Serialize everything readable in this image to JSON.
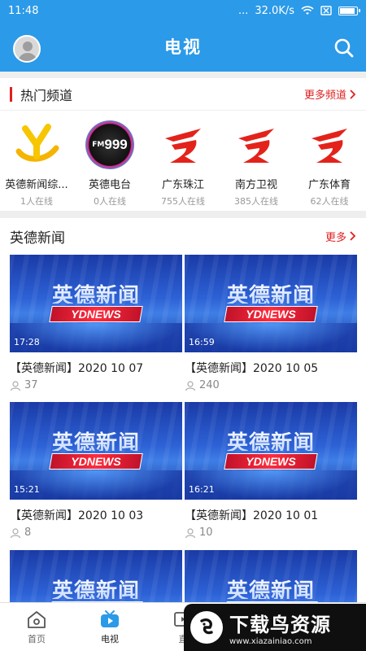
{
  "status": {
    "time": "11:48",
    "dots": "...",
    "speed": "32.0K/s"
  },
  "header": {
    "title": "电视"
  },
  "hot": {
    "title": "热门频道",
    "more": "更多频道",
    "channels": [
      {
        "name": "英德新闻综...",
        "viewers": "1人在线",
        "logo": "yingde-logo"
      },
      {
        "name": "英德电台",
        "viewers": "0人在线",
        "logo": "fm999-logo",
        "logo_text": "999",
        "logo_prefix": "FM"
      },
      {
        "name": "广东珠江",
        "viewers": "755人在线",
        "logo": "gdtv-logo"
      },
      {
        "name": "南方卫视",
        "viewers": "385人在线",
        "logo": "gdtv-logo"
      },
      {
        "name": "广东体育",
        "viewers": "62人在线",
        "logo": "gdtv-logo"
      }
    ]
  },
  "news": {
    "title": "英德新闻",
    "more": "更多",
    "thumb_title": "英德新闻",
    "thumb_band": "YDNEWS",
    "items": [
      {
        "title": "【英德新闻】2020 10 07",
        "duration": "17:28",
        "views": "37"
      },
      {
        "title": "【英德新闻】2020 10 05",
        "duration": "16:59",
        "views": "240"
      },
      {
        "title": "【英德新闻】2020 10 03",
        "duration": "15:21",
        "views": "8"
      },
      {
        "title": "【英德新闻】2020 10 01",
        "duration": "16:21",
        "views": "10"
      },
      {
        "title": "",
        "duration": "",
        "views": ""
      },
      {
        "title": "",
        "duration": "",
        "views": ""
      }
    ]
  },
  "tabs": [
    {
      "label": "首页",
      "icon": "home-icon"
    },
    {
      "label": "电视",
      "icon": "tv-icon",
      "active": true
    },
    {
      "label": "直",
      "icon": "live-icon"
    }
  ],
  "watermark": {
    "text": "下载鸟资源",
    "url": "www.xiazainiao.com"
  },
  "colors": {
    "brand": "#2b9ae8",
    "accent": "#e02020"
  }
}
